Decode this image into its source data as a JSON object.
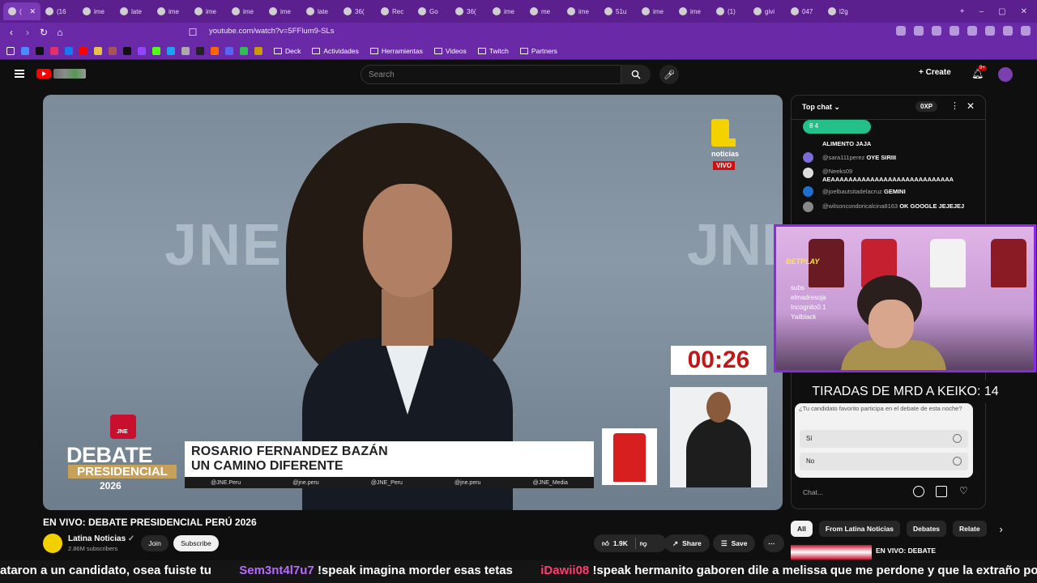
{
  "browser": {
    "tabs": [
      "(",
      "(16",
      "ime",
      "late",
      "ime",
      "ime",
      "ime",
      "ime",
      "late",
      "36(",
      "Rec",
      "Go",
      "36(",
      "ime",
      "me",
      "ime",
      "51u",
      "ime",
      "ime",
      "(1)",
      "givi",
      "047",
      "l2g"
    ],
    "url": "youtube.com/watch?v=5FFlum9-SLs",
    "bookmarks": [
      "Deck",
      "Actividades",
      "Herramientas",
      "Videos",
      "Twitch",
      "Partners"
    ]
  },
  "youtube": {
    "search_placeholder": "Search",
    "create_label": "Create",
    "notif_badge": "9+",
    "video_title": "EN VIVO: DEBATE PRESIDENCIAL PERÚ 2026",
    "channel_name": "Latina Noticias",
    "channel_subs": "2.86M subscribers",
    "join_label": "Join",
    "subscribe_label": "Subscribe",
    "likes": "1.9K",
    "share_label": "Share",
    "save_label": "Save",
    "chips": [
      "All",
      "From Latina Noticias",
      "Debates",
      "Relate"
    ],
    "rec_title": "EN VIVO: DEBATE"
  },
  "video": {
    "backdrop_left": "JNE",
    "backdrop_right": "JNE",
    "latina_text": "noticias",
    "vivo": "VIVO",
    "timer": "00:26",
    "debate_word": "DEBATE",
    "presidencial": "PRESIDENCIAL",
    "year": "2026",
    "jne_badge": "JNE",
    "candidate_name": "ROSARIO FERNANDEZ BAZÁN",
    "candidate_slogan": "UN CAMINO DIFERENTE",
    "socials": [
      "@JNE.Peru",
      "@jne.peru",
      "@JNE_Peru",
      "@jne.peru",
      "@JNE_Media"
    ]
  },
  "chat": {
    "title": "Top chat",
    "points": "0XP",
    "reactions": "8  4",
    "messages": [
      {
        "user": "",
        "text": "ALIMENTO JAJA"
      },
      {
        "user": "@sara111perez",
        "text": "OYE SIRIII"
      },
      {
        "user": "@Neeks09",
        "text": "AEAAAAAAAAAAAAAAAAAAAAAAAAAAAA"
      },
      {
        "user": "@joelbautsitadelacruz",
        "text": "GEMINI"
      },
      {
        "user": "@wilsoncondoricalcina8163",
        "text": "OK GOOGLE JEJEJEJ"
      }
    ],
    "poll_question": "¿Tu candidato favorito participa en el debate de esta noche?",
    "poll_options": [
      "Sí",
      "No"
    ],
    "input_placeholder": "Chat..."
  },
  "stream": {
    "betplay": "BETPLAY",
    "cam_names": [
      "subs",
      "elmadresoja",
      "Incognito0.1",
      "Yailblack"
    ],
    "overlay_text": "TIRADAS DE MRD A KEIKO: 14",
    "ticker": [
      {
        "user": "",
        "text": "ataron a un candidato, osea fuiste tu"
      },
      {
        "user": "Sem3nt4l7u7",
        "text": "!speak imagina morder esas tetas"
      },
      {
        "user": "iDawii08",
        "text": "!speak hermanito gaboren dile a melissa que me perdone y que la extraño porfavor"
      }
    ]
  },
  "colors": {
    "browser_purple": "#6a2aa8",
    "youtube_red": "#ff0000",
    "timer_red": "#c01818",
    "cam_border": "#8a2be2",
    "ticker_user": "#b66bff"
  }
}
